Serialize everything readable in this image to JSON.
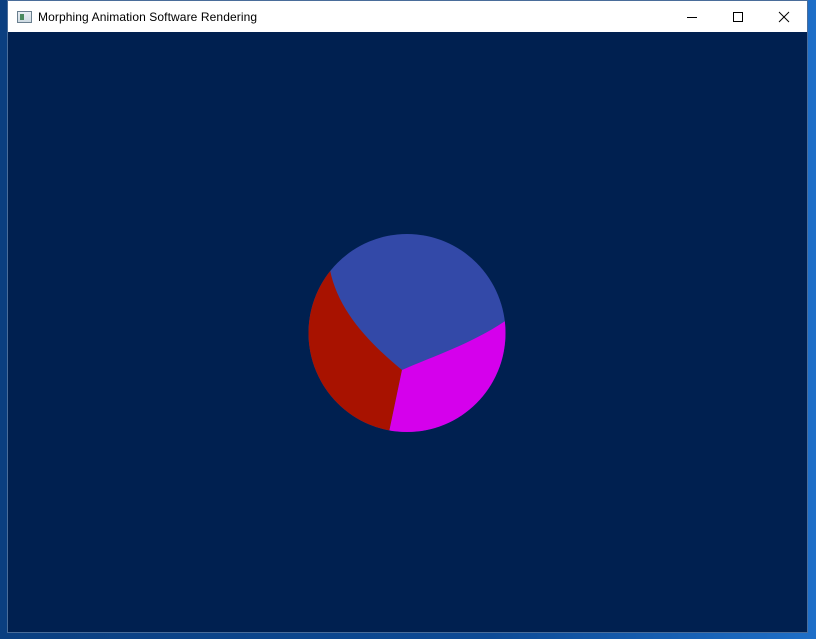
{
  "window": {
    "title": "Morphing Animation Software Rendering",
    "controls": {
      "minimize": "minimize-icon",
      "maximize": "maximize-icon",
      "close": "close-icon"
    }
  },
  "scene": {
    "background_color": "#002050",
    "object": "morphing-sphere",
    "colors": {
      "blue": "#3349a8",
      "red": "#a81200",
      "magenta": "#d500ec"
    }
  }
}
